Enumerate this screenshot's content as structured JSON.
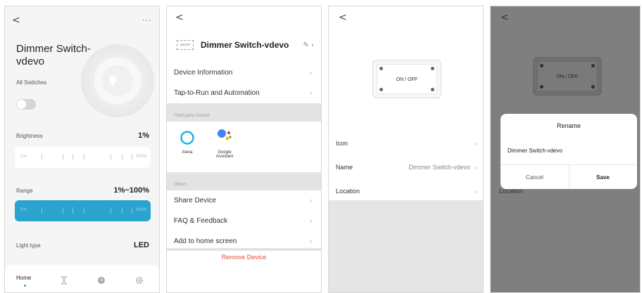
{
  "screen1": {
    "device_title": "Dimmer Switch-vdevo",
    "all_switches_label": "All Switches",
    "brightness_label": "Brightness",
    "brightness_value": "1%",
    "brightness_min": "1%",
    "brightness_max": "100%",
    "range_label": "Range",
    "range_value": "1%~100%",
    "range_min": "1%",
    "range_max": "100%",
    "light_type_label": "Light type",
    "light_type_value": "LED",
    "tabs": [
      "Home"
    ],
    "accent": "#2aa3cf",
    "icons": [
      "back-icon",
      "more-icon",
      "bulb-icon",
      "hourglass-icon",
      "clock-icon",
      "gear-icon"
    ]
  },
  "screen2": {
    "device_name": "Dimmer Switch-vdevo",
    "device_thumb_text": "ON/OFF",
    "rows": [
      "Device Information",
      "Tap-to-Run and Automation"
    ],
    "third_party_header": "Third-party Control",
    "alexa": "Alexa",
    "google_line1": "Google",
    "google_line2": "Assistant",
    "others_header": "Others",
    "other_rows": [
      "Share Device",
      "FAQ & Feedback",
      "Add to home screen"
    ],
    "remove": "Remove Device",
    "remove_color": "#e04a3a"
  },
  "screen3": {
    "switch_label": "ON / OFF",
    "rows": [
      {
        "label": "Icon",
        "value": ""
      },
      {
        "label": "Name",
        "value": "Dimmer Switch-vdevo"
      },
      {
        "label": "Location",
        "value": ""
      }
    ]
  },
  "screen4": {
    "switch_label": "ON / OFF",
    "dialog_title": "Rename",
    "dialog_value": "Dimmer Switch-vdevo",
    "cancel": "Cancel",
    "save": "Save",
    "ghost_location": "Location"
  }
}
